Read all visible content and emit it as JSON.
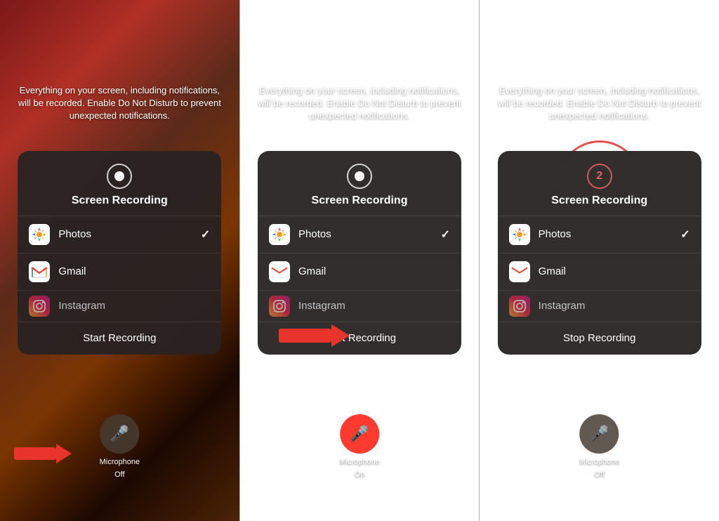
{
  "panels": [
    {
      "id": "panel-1",
      "description": "Everything on your screen, including notifications, will be recorded. Enable Do Not Disturb to prevent unexpected notifications.",
      "modal": {
        "title": "Screen Recording",
        "apps": [
          {
            "name": "Photos",
            "checked": true,
            "iconType": "photos"
          },
          {
            "name": "Gmail",
            "checked": false,
            "iconType": "gmail"
          },
          {
            "name": "Instagram",
            "checked": false,
            "iconType": "instagram"
          }
        ],
        "actionLabel": "Start Recording",
        "countdownVisible": false
      },
      "microphone": {
        "state": "off",
        "label": "Microphone",
        "sublabel": "Off",
        "active": false
      },
      "hasArrowToMic": true,
      "hasArrowToRecording": false
    },
    {
      "id": "panel-2",
      "description": "Everything on your screen, including notifications, will be recorded. Enable Do Not Disturb to prevent unexpected notifications.",
      "modal": {
        "title": "Screen Recording",
        "apps": [
          {
            "name": "Photos",
            "checked": true,
            "iconType": "photos"
          },
          {
            "name": "Gmail",
            "checked": false,
            "iconType": "gmail"
          },
          {
            "name": "Instagram",
            "checked": false,
            "iconType": "instagram"
          }
        ],
        "actionLabel": "Start Recording",
        "countdownVisible": false
      },
      "microphone": {
        "state": "on",
        "label": "Microphone",
        "sublabel": "On",
        "active": true
      },
      "hasArrowToMic": false,
      "hasArrowToRecording": true
    },
    {
      "id": "panel-3",
      "description": "Everything on your screen, including notifications, will be recorded. Enable Do Not Disturb to prevent unexpected notifications.",
      "modal": {
        "title": "Screen Recording",
        "apps": [
          {
            "name": "Photos",
            "checked": true,
            "iconType": "photos"
          },
          {
            "name": "Gmail",
            "checked": false,
            "iconType": "gmail"
          },
          {
            "name": "Instagram",
            "checked": false,
            "iconType": "instagram"
          }
        ],
        "actionLabel": "Stop Recording",
        "countdownVisible": true,
        "countdownNumber": "2"
      },
      "microphone": {
        "state": "off",
        "label": "Microphone",
        "sublabel": "Off",
        "active": false
      },
      "hasArrowToMic": false,
      "hasArrowToRecording": false,
      "hasCircleAnnotation": true
    }
  ]
}
